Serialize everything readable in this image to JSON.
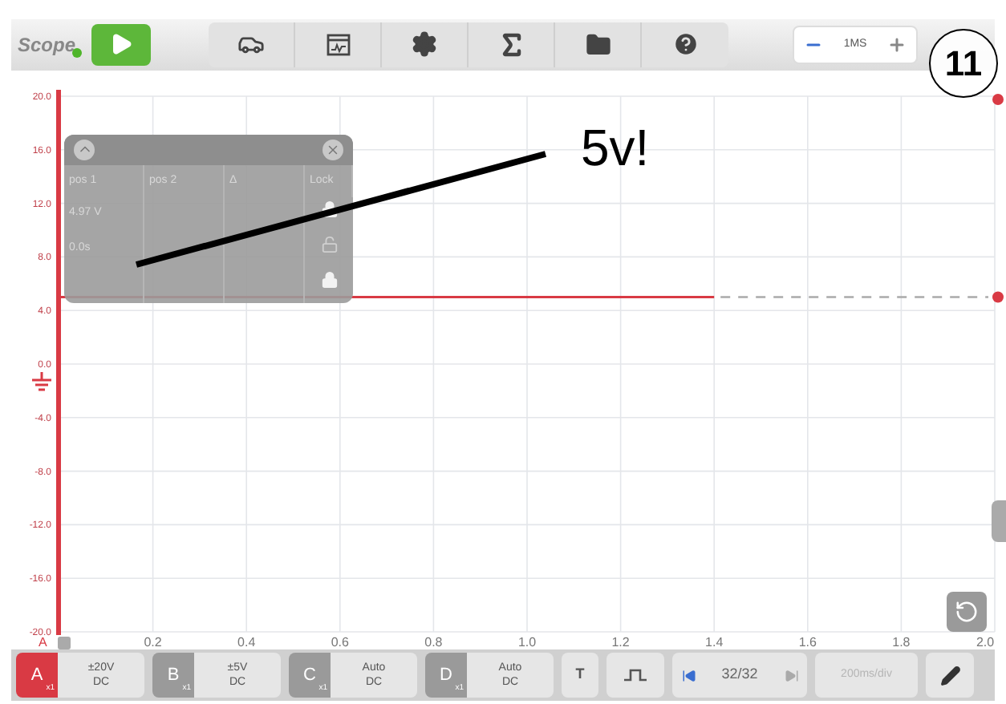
{
  "app": {
    "logo": "Scope",
    "running": false
  },
  "timebase": {
    "value": "1MS"
  },
  "callout": {
    "number": "11"
  },
  "annotation": {
    "text": "5v!"
  },
  "cursor_panel": {
    "columns": [
      "pos 1",
      "pos 2",
      "Δ",
      "Lock"
    ],
    "rows": [
      {
        "cells": [
          "4.97 V",
          "",
          ""
        ],
        "locked": true
      },
      {
        "cells": [
          "0.0s",
          "",
          ""
        ],
        "locked": false
      },
      {
        "cells": [
          "",
          "",
          ""
        ],
        "locked": true
      }
    ]
  },
  "plot": {
    "chart_data": {
      "type": "line",
      "x": [
        0,
        1.4
      ],
      "series": [
        {
          "name": "A",
          "color": "#d93a44",
          "values": [
            5,
            5
          ]
        }
      ],
      "xlim": [
        0,
        2.0
      ],
      "ylim": [
        -20,
        20
      ],
      "xticks": [
        {
          "value": 0.2,
          "label": "0.2"
        },
        {
          "value": 0.4,
          "label": "0.4"
        },
        {
          "value": 0.6,
          "label": "0.6"
        },
        {
          "value": 0.8,
          "label": "0.8"
        },
        {
          "value": 1.0,
          "label": "1.0"
        },
        {
          "value": 1.2,
          "label": "1.2"
        },
        {
          "value": 1.4,
          "label": "1.4"
        },
        {
          "value": 1.6,
          "label": "1.6"
        },
        {
          "value": 1.8,
          "label": "1.8"
        },
        {
          "value": 2.0,
          "label": "2.0"
        }
      ],
      "grid": true,
      "ref_lines": [
        {
          "axis": "y",
          "value": 5
        }
      ],
      "yticks": [
        {
          "value": 20,
          "label": "20.0"
        },
        {
          "value": 16,
          "label": "16.0"
        },
        {
          "value": 12,
          "label": "12.0"
        },
        {
          "value": 8,
          "label": "8.0"
        },
        {
          "value": 4,
          "label": "4.0"
        },
        {
          "value": 0,
          "label": "0.0"
        },
        {
          "value": -4,
          "label": "-4.0"
        },
        {
          "value": -8,
          "label": "-8.0"
        },
        {
          "value": -12,
          "label": "-12.0"
        },
        {
          "value": -16,
          "label": "-16.0"
        },
        {
          "value": -20,
          "label": "-20.0"
        }
      ]
    }
  },
  "channels": [
    {
      "letter": "A",
      "scale": "x1",
      "range": "±20V",
      "coupling": "DC",
      "selected": true
    },
    {
      "letter": "B",
      "scale": "x1",
      "range": "±5V",
      "coupling": "DC",
      "selected": false
    },
    {
      "letter": "C",
      "scale": "x1",
      "range": "Auto",
      "coupling": "DC",
      "selected": false
    },
    {
      "letter": "D",
      "scale": "x1",
      "range": "Auto",
      "coupling": "DC",
      "selected": false
    }
  ],
  "trigger": {
    "label": "T"
  },
  "frames": {
    "counter": "32/32",
    "next_disabled": true
  },
  "timebase_bottom": {
    "value": "200ms/div",
    "disabled": true
  }
}
